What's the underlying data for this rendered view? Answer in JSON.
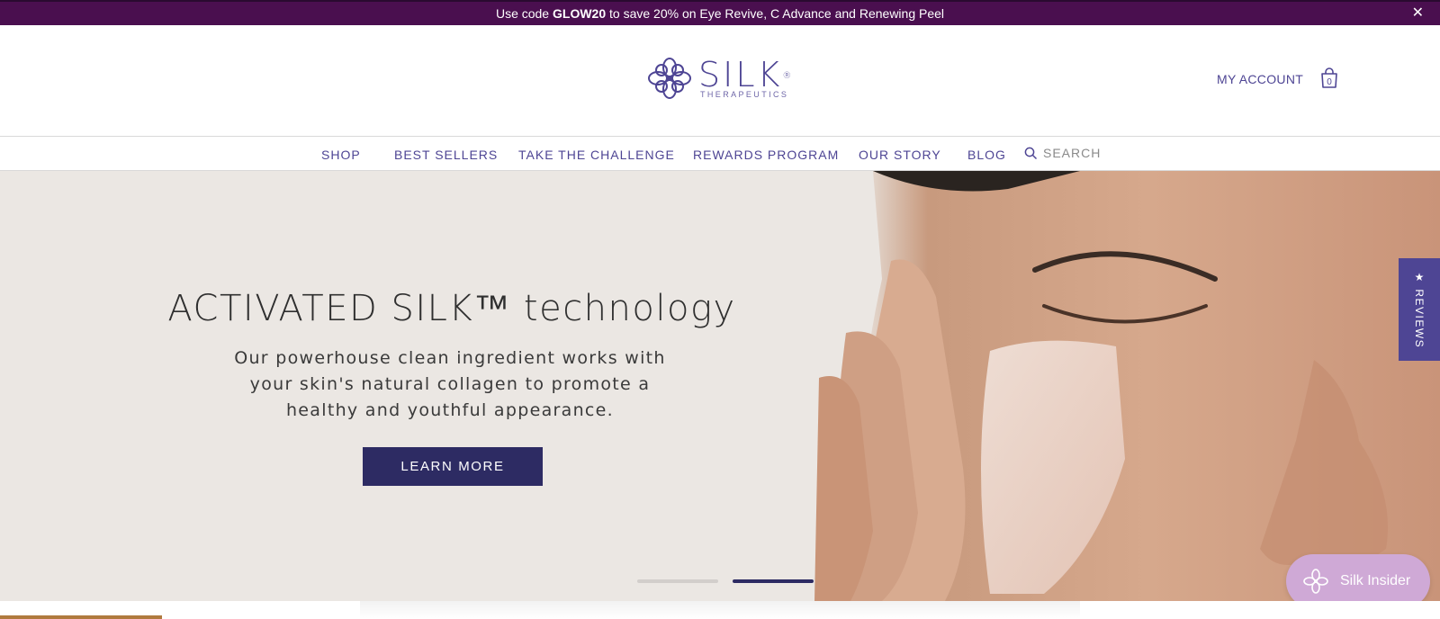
{
  "announcement": {
    "prefix": "Use code ",
    "code": "GLOW20",
    "suffix": " to save 20% on Eye Revive, C Advance and Renewing Peel",
    "close_label": "✕"
  },
  "header": {
    "logo_word": "SILK",
    "logo_registered": "®",
    "logo_sub": "THERAPEUTICS",
    "account_label": "MY ACCOUNT",
    "cart_count": "0"
  },
  "nav": {
    "items": [
      {
        "label": "SHOP"
      },
      {
        "label": "BEST SELLERS"
      },
      {
        "label": "TAKE THE CHALLENGE"
      },
      {
        "label": "REWARDS PROGRAM"
      },
      {
        "label": "OUR STORY"
      },
      {
        "label": "BLOG"
      }
    ],
    "search_placeholder": "SEARCH"
  },
  "hero": {
    "title": "ACTIVATED SILK™ technology",
    "text": "Our powerhouse clean ingredient works with your skin's natural collagen to promote a healthy and youthful appearance.",
    "button_label": "LEARN MORE",
    "slide_count": 2,
    "active_slide": 2
  },
  "reviews_tab": {
    "label": "★ REVIEWS"
  },
  "insider_widget": {
    "label": "Silk Insider"
  },
  "colors": {
    "brand": "#4e4594",
    "announcement_bg": "#4a0f4f",
    "button_bg": "#2d2b63",
    "hero_bg": "#ebe7e3",
    "insider_bg": "#cfa9d6"
  }
}
